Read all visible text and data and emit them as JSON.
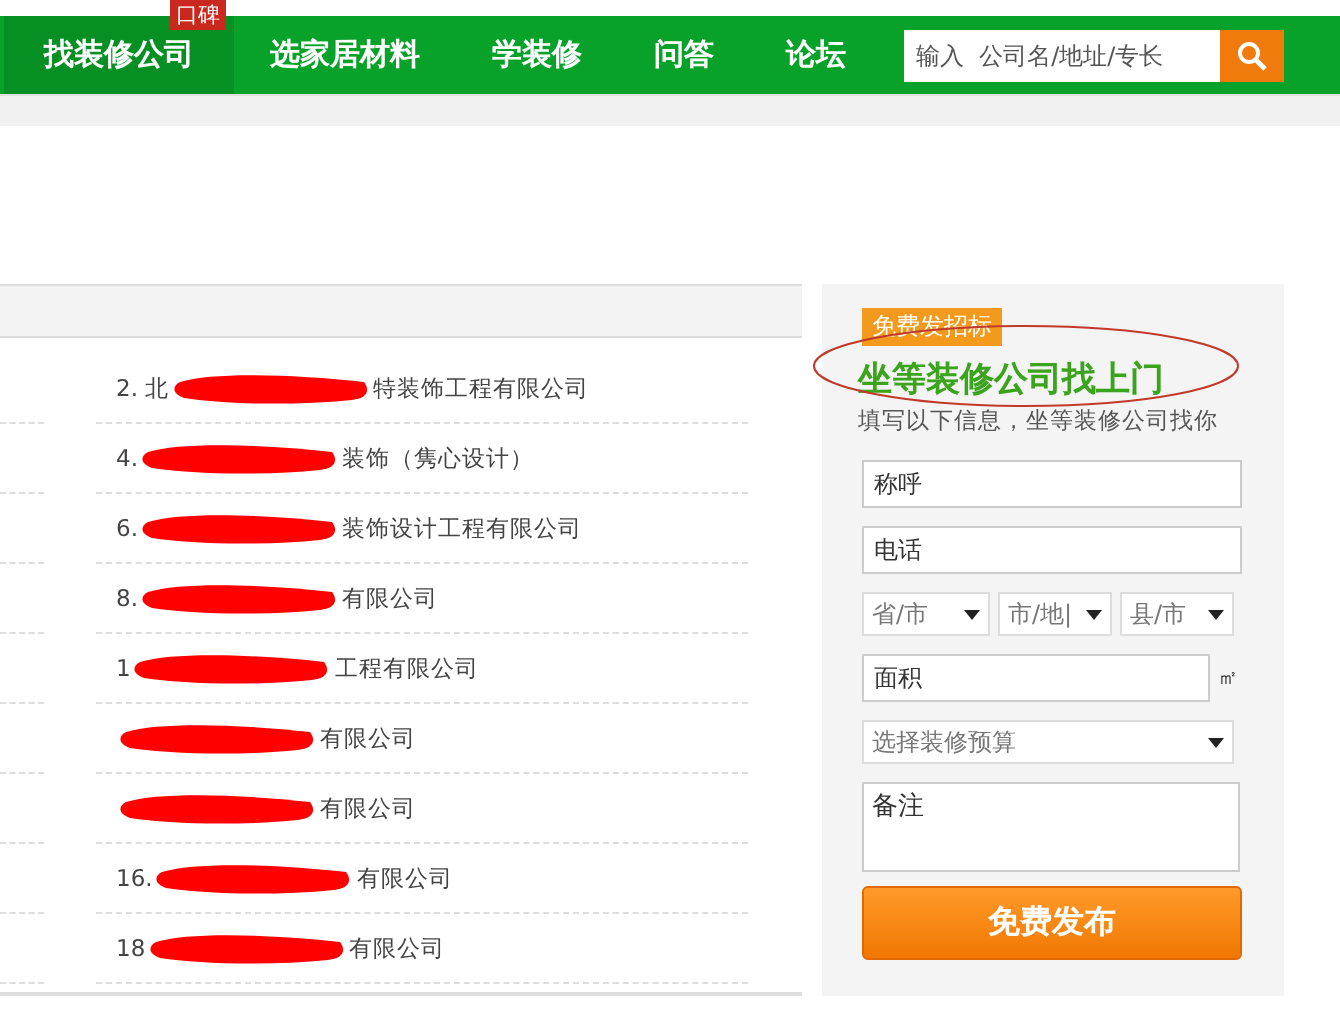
{
  "nav": {
    "items": [
      {
        "label": "找装修公司",
        "selected": true,
        "badge": "口碑"
      },
      {
        "label": "选家居材料",
        "selected": false
      },
      {
        "label": "学装修",
        "selected": false
      },
      {
        "label": "问答",
        "selected": false
      },
      {
        "label": "论坛",
        "selected": false
      }
    ],
    "search": {
      "placeholder": "输入  公司名/地址/专长"
    }
  },
  "companies": [
    {
      "prefix": "2. 北",
      "suffix": "特装饰工程有限公司"
    },
    {
      "prefix": "4.",
      "suffix": "装饰（隽心设计）"
    },
    {
      "prefix": "6.",
      "suffix": "装饰设计工程有限公司"
    },
    {
      "prefix": "8.",
      "suffix": "有限公司"
    },
    {
      "prefix": "1",
      "suffix": "工程有限公司"
    },
    {
      "suffix": "有限公司"
    },
    {
      "suffix": "有限公司"
    },
    {
      "prefix": "16.",
      "suffix": "有限公司"
    },
    {
      "prefix": "18",
      "suffix": "有限公司"
    }
  ],
  "form": {
    "tag": "免费发招标",
    "title": "坐等装修公司找上门",
    "subtitle": "填写以下信息，坐等装修公司找你",
    "fields": [
      {
        "kind": "text",
        "placeholder": "称呼"
      },
      {
        "kind": "text",
        "placeholder": "电话"
      },
      {
        "kind": "selects",
        "options": [
          "省/市",
          "市/地|",
          "县/市"
        ]
      },
      {
        "kind": "area",
        "placeholder": "面积",
        "unit": "㎡"
      },
      {
        "kind": "select",
        "placeholder": "选择装修预算"
      },
      {
        "kind": "textarea",
        "placeholder": "备注"
      }
    ],
    "submit": "免费发布"
  }
}
